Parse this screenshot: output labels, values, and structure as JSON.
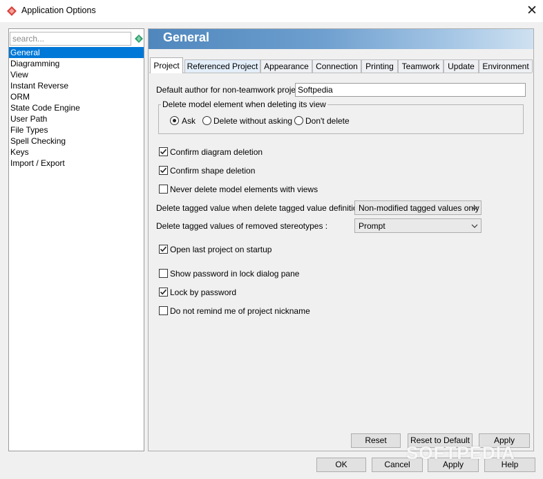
{
  "window": {
    "title": "Application Options",
    "close_glyph": "✕"
  },
  "sidebar": {
    "search_placeholder": "search...",
    "items": [
      {
        "label": "General",
        "selected": true
      },
      {
        "label": "Diagramming"
      },
      {
        "label": "View"
      },
      {
        "label": "Instant Reverse"
      },
      {
        "label": "ORM"
      },
      {
        "label": "State Code Engine"
      },
      {
        "label": "User Path"
      },
      {
        "label": "File Types"
      },
      {
        "label": "Spell Checking"
      },
      {
        "label": "Keys"
      },
      {
        "label": "Import / Export"
      }
    ]
  },
  "banner": {
    "title": "General"
  },
  "tabs": [
    {
      "label": "Project",
      "active": true
    },
    {
      "label": "Referenced Project"
    },
    {
      "label": "Appearance"
    },
    {
      "label": "Connection"
    },
    {
      "label": "Printing"
    },
    {
      "label": "Teamwork"
    },
    {
      "label": "Update"
    },
    {
      "label": "Environment"
    }
  ],
  "project": {
    "default_author_label": "Default author for non-teamwork project:",
    "default_author_value": "Softpedia",
    "delete_group_title": "Delete model element when deleting its view",
    "delete_options": [
      {
        "label": "Ask",
        "selected": true
      },
      {
        "label": "Delete without asking",
        "selected": false
      },
      {
        "label": "Don't delete",
        "selected": false
      }
    ],
    "confirm_diagram_deletion": {
      "label": "Confirm diagram deletion",
      "checked": true
    },
    "confirm_shape_deletion": {
      "label": "Confirm shape deletion",
      "checked": true
    },
    "never_delete_model_elements": {
      "label": "Never delete model elements with views",
      "checked": false
    },
    "delete_tagged_value_label": "Delete tagged value when delete tagged value definitions :",
    "delete_tagged_value_selected": "Non-modified tagged values only",
    "delete_tagged_values_stereotypes_label": "Delete tagged values of removed stereotypes :",
    "delete_tagged_values_stereotypes_selected": "Prompt",
    "open_last_project": {
      "label": "Open last project on startup",
      "checked": true
    },
    "show_password": {
      "label": "Show password in lock dialog pane",
      "checked": false
    },
    "lock_by_password": {
      "label": "Lock by password",
      "checked": true
    },
    "do_not_remind_nickname": {
      "label": "Do not remind me of project nickname",
      "checked": false
    }
  },
  "panel_buttons": {
    "reset": "Reset",
    "reset_to_default": "Reset to Default",
    "apply": "Apply"
  },
  "dialog_buttons": {
    "ok": "OK",
    "cancel": "Cancel",
    "apply": "Apply",
    "help": "Help"
  },
  "watermark": "SOFTPEDIA",
  "colors": {
    "selection": "#0078d7",
    "banner_start": "#4f87bd",
    "banner_end": "#cfe1f1",
    "app_icon": "#d9413a",
    "search_gem": "#2e9e6e"
  }
}
